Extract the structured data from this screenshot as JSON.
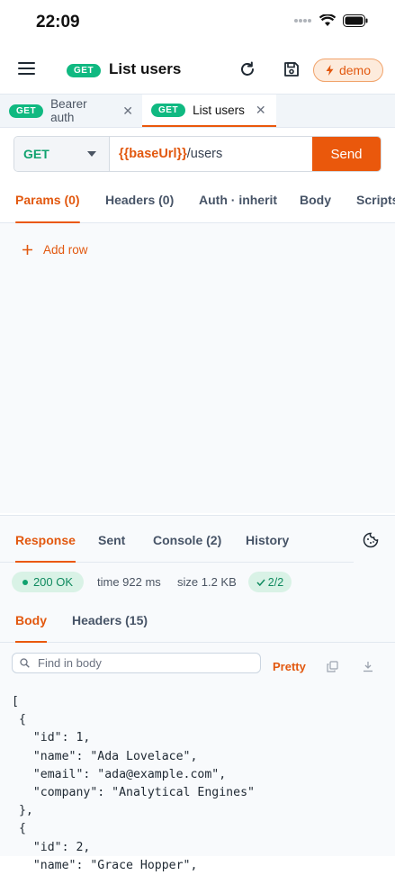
{
  "status_bar": {
    "time": "22:09"
  },
  "header": {
    "method_badge": "GET",
    "title": "List users",
    "env_badge": "demo",
    "icons": [
      "menu-icon",
      "refresh-icon",
      "save-icon",
      "lightning-icon"
    ]
  },
  "tabs": [
    {
      "method": "GET",
      "label": "Bearer auth",
      "active": false
    },
    {
      "method": "GET",
      "label": "List users",
      "active": true
    }
  ],
  "request": {
    "method": "GET",
    "url_variable": "{{baseUrl}}",
    "url_path": "/users",
    "send_label": "Send"
  },
  "request_tabs": [
    "Params (0)",
    "Headers (0)",
    "Auth · inherit",
    "Body",
    "Scripts"
  ],
  "params": {
    "add_row_label": "Add row"
  },
  "response_tabs": [
    "Response",
    "Sent",
    "Console (2)",
    "History"
  ],
  "response": {
    "status": "200 OK",
    "time": "time 922 ms",
    "size": "size 1.2 KB",
    "tests": "2/2",
    "body_tabs": [
      "Body",
      "Headers (15)"
    ],
    "find_placeholder": "Find in body",
    "format_label": "Pretty",
    "body": "[\n {\n   \"id\": 1,\n   \"name\": \"Ada Lovelace\",\n   \"email\": \"ada@example.com\",\n   \"company\": \"Analytical Engines\"\n },\n {\n   \"id\": 2,\n   \"name\": \"Grace Hopper\","
  },
  "colors": {
    "accent": "#ea580c",
    "get_green": "#10b981",
    "ok_bg": "#d9f2e6"
  }
}
